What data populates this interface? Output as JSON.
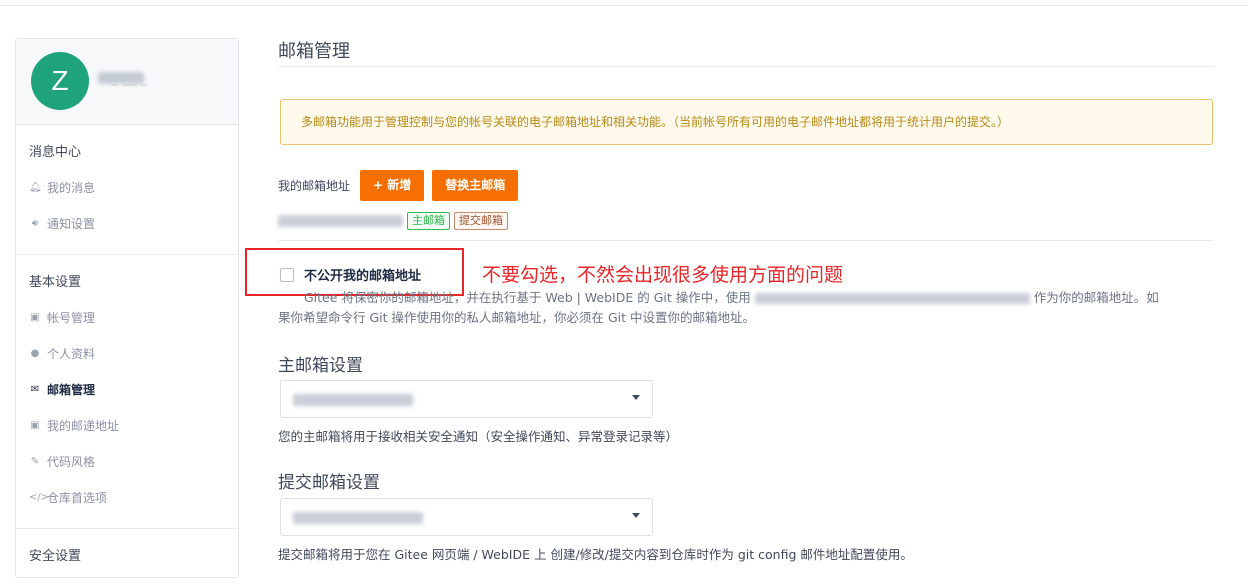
{
  "sidebar": {
    "avatar_letter": "Z",
    "username": "_ __ _",
    "groups": [
      {
        "title": "消息中心",
        "items": [
          {
            "label": "我的消息",
            "icon": "bell-icon"
          },
          {
            "label": "通知设置",
            "icon": "speaker-icon"
          }
        ]
      },
      {
        "title": "基本设置",
        "items": [
          {
            "label": "帐号管理",
            "icon": "id-card-icon"
          },
          {
            "label": "个人资料",
            "icon": "user-icon"
          },
          {
            "label": "邮箱管理",
            "icon": "envelope-icon"
          },
          {
            "label": "我的邮递地址",
            "icon": "address-card-icon"
          },
          {
            "label": "代码风格",
            "icon": "brush-icon"
          },
          {
            "label": "仓库首选项",
            "icon": "code-icon"
          }
        ]
      },
      {
        "title": "安全设置",
        "items": []
      }
    ]
  },
  "main": {
    "title": "邮箱管理",
    "notice": "多邮箱功能用于管理控制与您的帐号关联的电子邮箱地址和相关功能。（当前帐号所有可用的电子邮件地址都将用于统计用户的提交。）",
    "email_label": "我的邮箱地址",
    "add_button": "+ 新增",
    "replace_button": "替换主邮箱",
    "tag_primary": "主邮箱",
    "tag_commit": "提交邮箱",
    "private_checkbox_label": "不公开我的邮箱地址",
    "annotation": "不要勾选，不然会出现很多使用方面的问题",
    "private_desc_1": "Gitee 将保密你的邮箱地址，并在执行基于 Web | WebIDE 的 Git 操作中，使用",
    "private_desc_2": "作为你的邮箱地址。如",
    "private_desc_3": "果你希望命令行 Git 操作使用你的私人邮箱地址，你必须在 Git 中设置你的邮箱地址。",
    "primary_section_title": "主邮箱设置",
    "primary_help": "您的主邮箱将用于接收相关安全通知（安全操作通知、异常登录记录等）",
    "commit_section_title": "提交邮箱设置",
    "commit_help": "提交邮箱将用于您在 Gitee 网页端 / WebIDE 上 创建/修改/提交内容到仓库时作为 git config 邮件地址配置使用。"
  },
  "colors": {
    "accent": "#f66f00",
    "avatar_bg": "#1fa37a",
    "annotation_red": "#e8262a",
    "notice_bg": "#fffaeb",
    "notice_text": "#b88a18"
  }
}
